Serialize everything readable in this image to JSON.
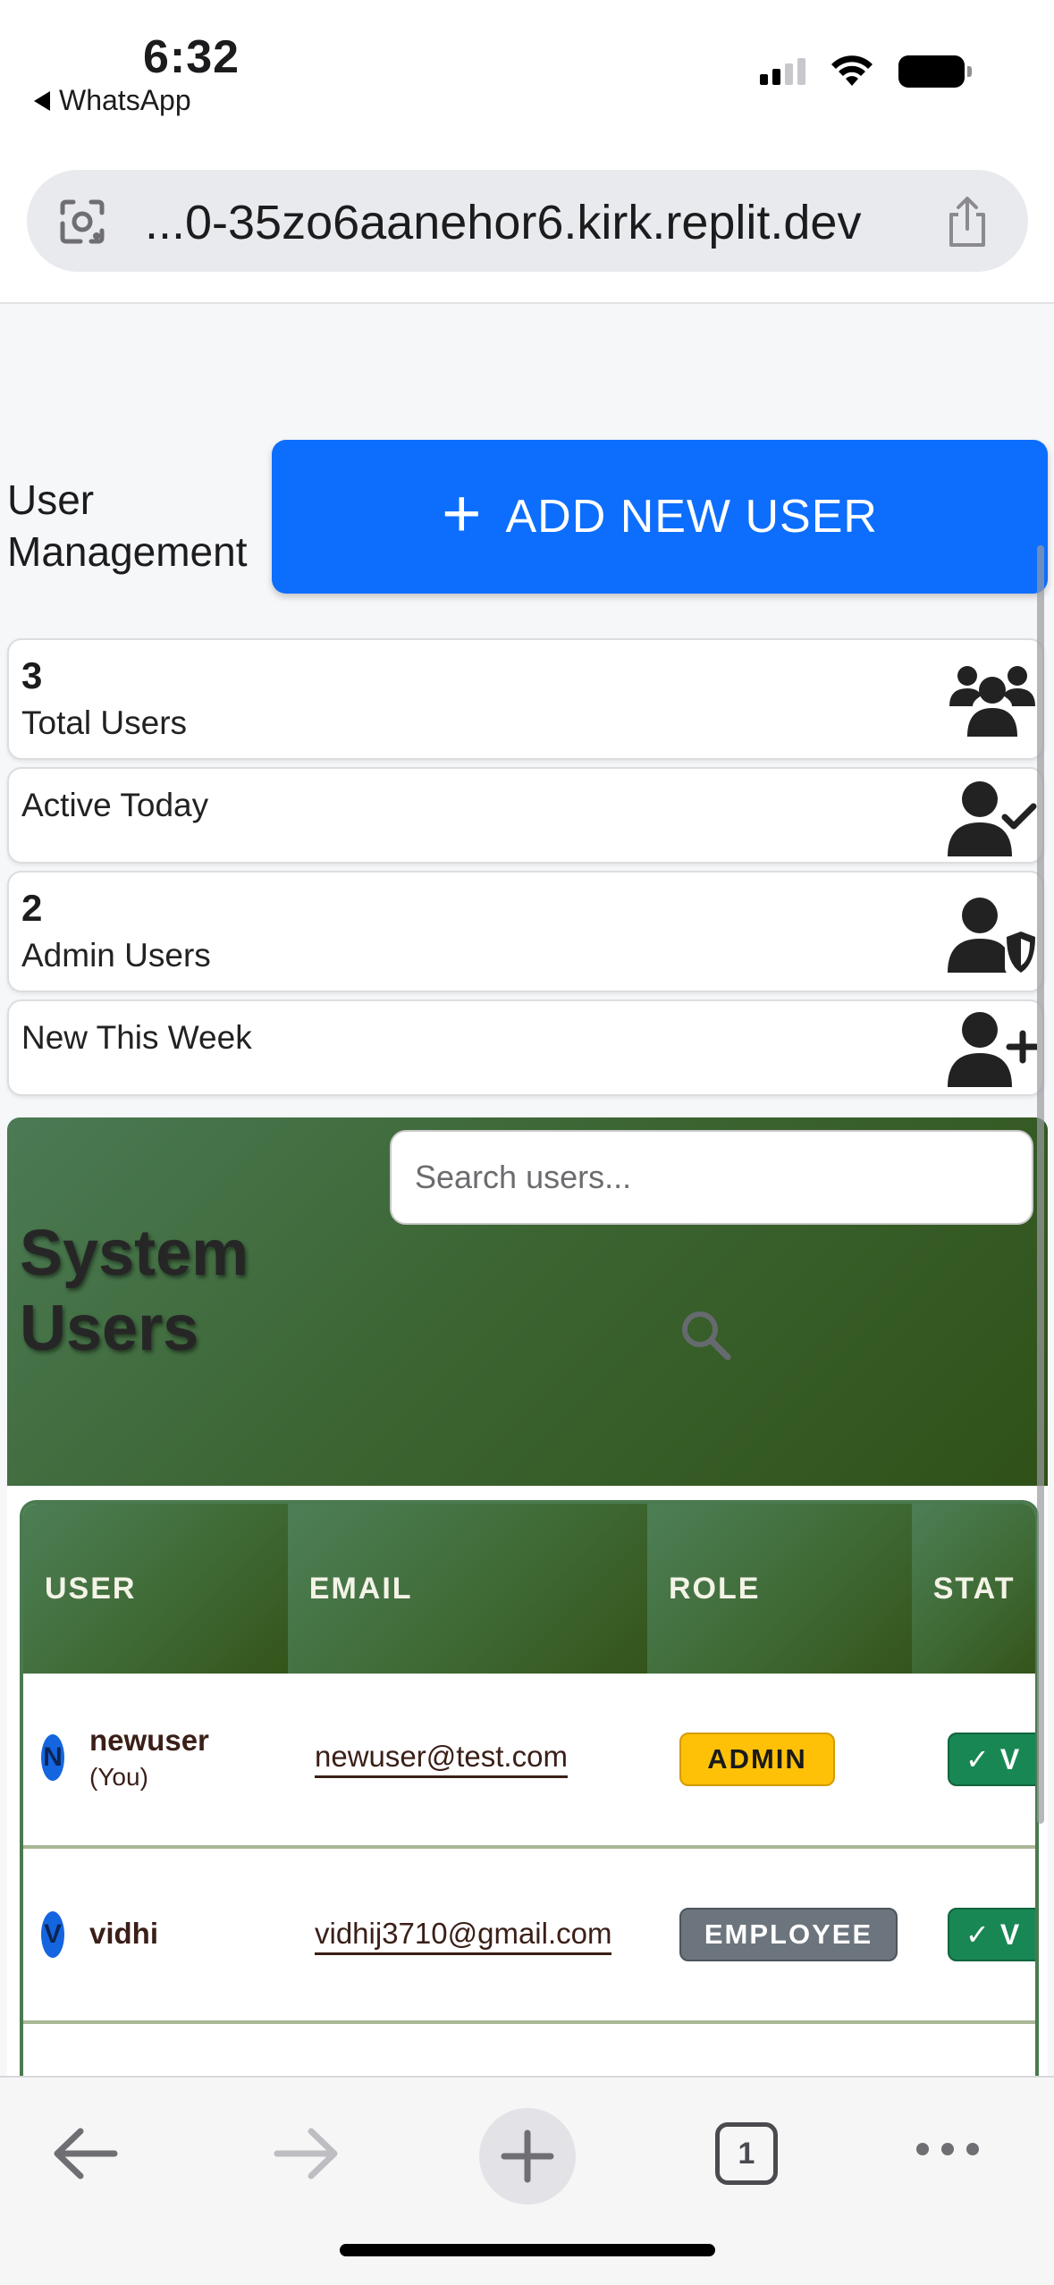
{
  "status_bar": {
    "time": "6:32",
    "back_app": "WhatsApp"
  },
  "browser": {
    "url": "...0-35zo6aanehor6.kirk.replit.dev",
    "tab_count": "1"
  },
  "page": {
    "title_line1": "User",
    "title_line2": "Management",
    "add_button": "ADD NEW USER",
    "add_button_icon": "+"
  },
  "stats": [
    {
      "value": "3",
      "label": "Total Users",
      "icon": "users-icon"
    },
    {
      "value": "",
      "label": "Active Today",
      "icon": "user-check-icon"
    },
    {
      "value": "2",
      "label": "Admin Users",
      "icon": "user-shield-icon"
    },
    {
      "value": "",
      "label": "New This Week",
      "icon": "user-plus-icon"
    }
  ],
  "system_users": {
    "title_line1": "System",
    "title_line2": "Users",
    "search_placeholder": "Search users...",
    "columns": [
      "USER",
      "EMAIL",
      "ROLE",
      "STAT"
    ],
    "rows": [
      {
        "initial": "N",
        "name": "newuser",
        "you": "(You)",
        "email": "newuser@test.com",
        "role": "ADMIN",
        "status": "V"
      },
      {
        "initial": "V",
        "name": "vidhi",
        "you": "",
        "email": "vidhij3710@gmail.com",
        "role": "EMPLOYEE",
        "status": "V"
      }
    ]
  },
  "colors": {
    "primary": "#0d6efd",
    "header_green": "#3c6533",
    "admin_badge": "#ffc107",
    "employee_badge": "#6c757d",
    "status_green": "#198754"
  }
}
